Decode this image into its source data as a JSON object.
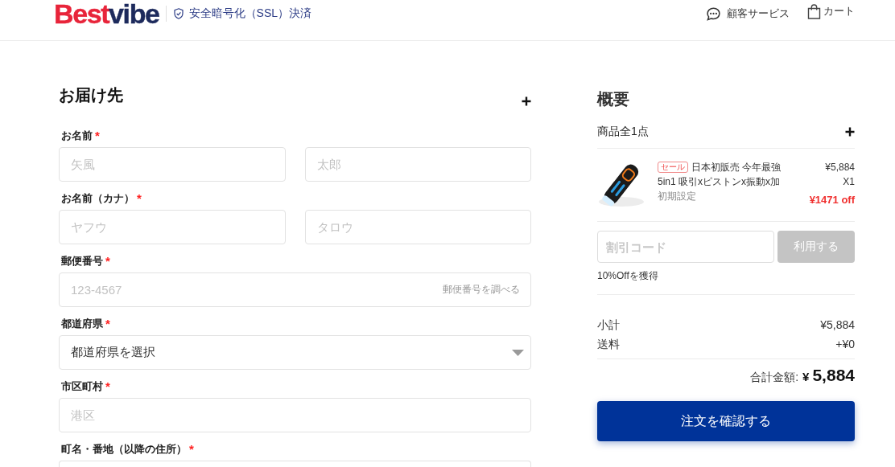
{
  "header": {
    "logo": [
      "Best",
      "vibe"
    ],
    "security_note": "安全暗号化（SSL）決済",
    "links": [
      {
        "kind": "support",
        "label": "顧客サービス"
      },
      {
        "kind": "cart",
        "label": "カート"
      }
    ]
  },
  "shipping_form": {
    "title": "お届け先",
    "fields": [
      {
        "kind": "pair",
        "label": "お名前",
        "required_mark": "*",
        "inputs": [
          {
            "placeholder": "矢風"
          },
          {
            "placeholder": "太郎"
          }
        ]
      },
      {
        "kind": "pair",
        "label": "お名前（カナ）",
        "required_mark": "*",
        "inputs": [
          {
            "placeholder": "ヤフウ"
          },
          {
            "placeholder": "タロウ"
          }
        ]
      },
      {
        "kind": "input",
        "label": "郵便番号",
        "required_mark": "*",
        "placeholder": "123-4567",
        "link": "郵便番号を調べる"
      },
      {
        "kind": "select",
        "label": "都道府県",
        "required_mark": "*",
        "value": "都道府県を選択"
      },
      {
        "kind": "input",
        "label": "市区町村",
        "required_mark": "*",
        "placeholder": "港区"
      },
      {
        "kind": "input",
        "label": "町名・番地（以降の住所）",
        "required_mark": "*"
      }
    ]
  },
  "order_summary": {
    "title": "概要",
    "items_heading": "商品全1点",
    "items": [
      {
        "badge": "セール",
        "title": "日本初販売 今年最強 5in1 吸引xピストンx振動x加",
        "variant": "初期設定",
        "price": "¥5,884",
        "quantity": "X1",
        "discount": "¥1471 off"
      }
    ],
    "discount_code": {
      "placeholder": "割引コード",
      "button": {
        "label": "利用する",
        "disabled": true
      },
      "note": "10%Offを獲得"
    },
    "lines": [
      {
        "label": "小計",
        "value": "¥5,884"
      },
      {
        "label": "送料",
        "value": "+¥0"
      }
    ],
    "total": {
      "label": "合計金額:",
      "currency": "¥",
      "amount": "5,884"
    },
    "checkout_button": "注文を確認する"
  }
}
